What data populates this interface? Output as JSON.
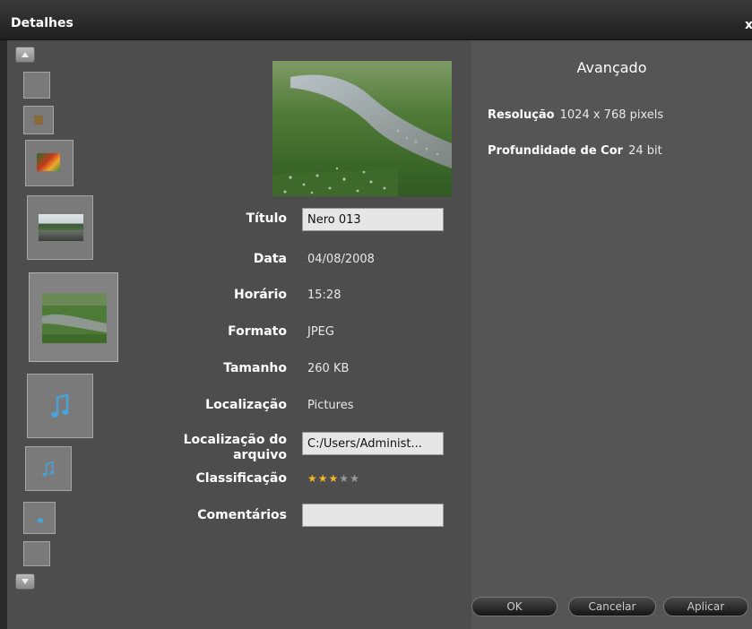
{
  "window": {
    "title": "Detalhes",
    "close_glyph": "x"
  },
  "filmstrip": {
    "up_icon": "arrow-up-icon",
    "down_icon": "arrow-down-icon",
    "items": [
      {
        "kind": "empty"
      },
      {
        "kind": "image-small"
      },
      {
        "kind": "image-colorful"
      },
      {
        "kind": "image-landscape"
      },
      {
        "kind": "image-selected"
      },
      {
        "kind": "music-icon"
      },
      {
        "kind": "music-icon"
      },
      {
        "kind": "music-icon"
      },
      {
        "kind": "empty"
      }
    ]
  },
  "details": {
    "title": {
      "label": "Título",
      "value": "Nero 013"
    },
    "date": {
      "label": "Data",
      "value": "04/08/2008"
    },
    "time": {
      "label": "Horário",
      "value": "15:28"
    },
    "format": {
      "label": "Formato",
      "value": "JPEG"
    },
    "size": {
      "label": "Tamanho",
      "value": "260 KB"
    },
    "location": {
      "label": "Localização",
      "value": "Pictures"
    },
    "file_location": {
      "label_line1": "Localização do",
      "label_line2": "arquivo",
      "value": "C:/Users/Administ..."
    },
    "rating": {
      "label": "Classificação",
      "stars_filled": 3,
      "stars_total": 5,
      "filled_color": "#f2b62a",
      "empty_color": "#9a9a9a"
    },
    "comments": {
      "label": "Comentários",
      "value": ""
    }
  },
  "advanced": {
    "heading": "Avançado",
    "resolution": {
      "label": "Resolução",
      "value": "1024 x 768 pixels"
    },
    "color_depth": {
      "label": "Profundidade de Cor",
      "value": "24 bit"
    }
  },
  "buttons": {
    "ok": "OK",
    "cancel": "Cancelar",
    "apply": "Aplicar"
  }
}
